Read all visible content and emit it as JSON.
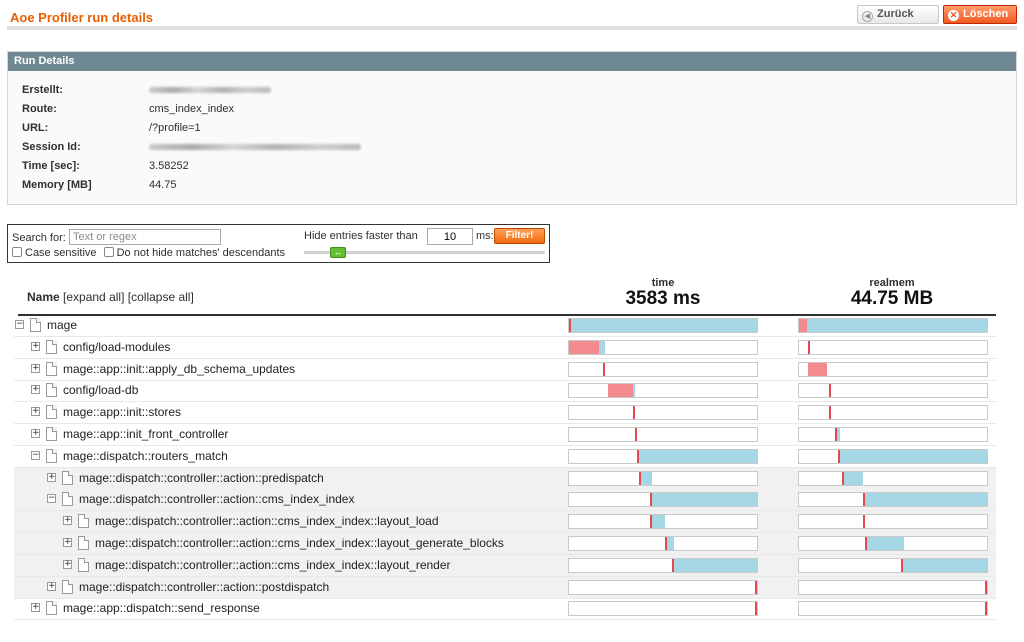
{
  "header": {
    "title": "Aoe Profiler run details",
    "back_label": "Zurück",
    "delete_label": "Löschen",
    "back_icon": "chevron-left-circle-icon",
    "delete_icon": "x-circle-icon"
  },
  "details": {
    "heading": "Run Details",
    "rows": [
      {
        "key": "Erstellt:",
        "value": "",
        "redacted": true
      },
      {
        "key": "Route:",
        "value": "cms_index_index",
        "redacted": false
      },
      {
        "key": "URL:",
        "value": "/?profile=1",
        "redacted": false
      },
      {
        "key": "Session Id:",
        "value": "",
        "redacted": true
      },
      {
        "key": "Time [sec]:",
        "value": "3.58252",
        "redacted": false
      },
      {
        "key": "Memory [MB]",
        "value": "44.75",
        "redacted": false
      }
    ]
  },
  "filter": {
    "search_label": "Search for:",
    "search_placeholder": "Text or regex",
    "search_value": "",
    "case_sensitive_label": "Case sensitive",
    "case_sensitive_checked": false,
    "no_hide_label": "Do not hide matches' descendants",
    "no_hide_checked": false,
    "hide_label": "Hide entries faster than",
    "ms_value": "10",
    "ms_label": "ms:",
    "filter_button": "Filter!",
    "slider_level": 0.12
  },
  "tree_header": {
    "name_label": "Name",
    "expand_all": "[expand all]",
    "collapse_all": "[collapse all]",
    "time_label": "time",
    "time_total": "3583 ms",
    "mem_label": "realmem",
    "mem_total": "44.75 MB"
  },
  "rows": [
    {
      "name": "mage",
      "depth": 0,
      "toggle": "collapse",
      "time": {
        "s": 0.0,
        "r": 0.01,
        "b": 0.99
      },
      "mem": {
        "s": 0.0,
        "r": 0.04,
        "b": 0.96
      }
    },
    {
      "name": "config/load-modules",
      "depth": 1,
      "toggle": "expand",
      "time": {
        "s": 0.0,
        "r": 0.16,
        "b": 0.03
      },
      "mem": {
        "s": 0.05,
        "r": 0.01,
        "b": 0.0
      }
    },
    {
      "name": "mage::app::init::apply_db_schema_updates",
      "depth": 1,
      "toggle": "expand",
      "time": {
        "s": 0.18,
        "r": 0.02,
        "b": 0.0
      },
      "mem": {
        "s": 0.05,
        "r": 0.1,
        "b": 0.0
      }
    },
    {
      "name": "config/load-db",
      "depth": 1,
      "toggle": "expand",
      "time": {
        "s": 0.21,
        "r": 0.13,
        "b": 0.01
      },
      "mem": {
        "s": 0.16,
        "r": 0.01,
        "b": 0.0
      }
    },
    {
      "name": "mage::app::init::stores",
      "depth": 1,
      "toggle": "expand",
      "time": {
        "s": 0.34,
        "r": 0.01,
        "b": 0.0
      },
      "mem": {
        "s": 0.16,
        "r": 0.01,
        "b": 0.0
      }
    },
    {
      "name": "mage::app::init_front_controller",
      "depth": 1,
      "toggle": "expand",
      "time": {
        "s": 0.35,
        "r": 0.01,
        "b": 0.0
      },
      "mem": {
        "s": 0.19,
        "r": 0.01,
        "b": 0.02
      }
    },
    {
      "name": "mage::dispatch::routers_match",
      "depth": 1,
      "toggle": "collapse",
      "time": {
        "s": 0.36,
        "r": 0.01,
        "b": 0.63
      },
      "mem": {
        "s": 0.21,
        "r": 0.01,
        "b": 0.78
      }
    },
    {
      "name": "mage::dispatch::controller::action::predispatch",
      "depth": 2,
      "toggle": "expand",
      "time": {
        "s": 0.37,
        "r": 0.01,
        "b": 0.06
      },
      "mem": {
        "s": 0.23,
        "r": 0.01,
        "b": 0.1
      }
    },
    {
      "name": "mage::dispatch::controller::action::cms_index_index",
      "depth": 2,
      "toggle": "collapse",
      "time": {
        "s": 0.43,
        "r": 0.01,
        "b": 0.56
      },
      "mem": {
        "s": 0.34,
        "r": 0.01,
        "b": 0.65
      }
    },
    {
      "name": "mage::dispatch::controller::action::cms_index_index::layout_load",
      "depth": 3,
      "toggle": "expand",
      "time": {
        "s": 0.43,
        "r": 0.01,
        "b": 0.07
      },
      "mem": {
        "s": 0.34,
        "r": 0.01,
        "b": 0.0
      }
    },
    {
      "name": "mage::dispatch::controller::action::cms_index_index::layout_generate_blocks",
      "depth": 3,
      "toggle": "expand",
      "time": {
        "s": 0.51,
        "r": 0.01,
        "b": 0.04
      },
      "mem": {
        "s": 0.35,
        "r": 0.01,
        "b": 0.2
      }
    },
    {
      "name": "mage::dispatch::controller::action::cms_index_index::layout_render",
      "depth": 3,
      "toggle": "expand",
      "time": {
        "s": 0.55,
        "r": 0.01,
        "b": 0.44
      },
      "mem": {
        "s": 0.54,
        "r": 0.01,
        "b": 0.45
      }
    },
    {
      "name": "mage::dispatch::controller::action::postdispatch",
      "depth": 2,
      "toggle": "expand",
      "time": {
        "s": 0.99,
        "r": 0.01,
        "b": 0.0
      },
      "mem": {
        "s": 0.99,
        "r": 0.01,
        "b": 0.0
      }
    },
    {
      "name": "mage::app::dispatch::send_response",
      "depth": 1,
      "toggle": "expand",
      "time": {
        "s": 0.99,
        "r": 0.01,
        "b": 0.0
      },
      "mem": {
        "s": 0.99,
        "r": 0.01,
        "b": 0.0
      }
    }
  ]
}
